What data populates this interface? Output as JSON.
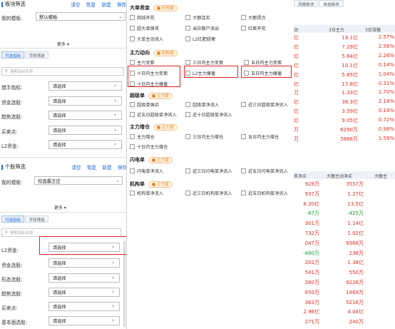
{
  "board_filter": {
    "title": "板块筛选",
    "actions": [
      "请空",
      "恢复",
      "新建",
      "保存"
    ],
    "template_label": "我的模板:",
    "template_value": "默认模板",
    "more": "更多",
    "tabs": [
      "可选指标",
      "字段筛选"
    ],
    "search_placeholder": "搜索指标名称",
    "filters": [
      {
        "label": "猎手指标:",
        "value": "请选择"
      },
      {
        "label": "资金选股:",
        "value": "请选择"
      },
      {
        "label": "趋势选股:",
        "value": "请选择"
      },
      {
        "label": "买卖点:",
        "value": "请选择"
      },
      {
        "label": "L2资金:",
        "value": "请选择"
      }
    ]
  },
  "stock_filter": {
    "title": "个股筛选",
    "actions": [
      "请空",
      "恢复",
      "新建",
      "保存"
    ],
    "template_label": "我的模板:",
    "template_value": "控盘霸王庄",
    "more": "更多",
    "tabs": [
      "可选指标",
      "字段筛选"
    ],
    "search_placeholder": "搜索指标名称",
    "filters": [
      {
        "label": "L2资金:",
        "value": "请选择"
      },
      {
        "label": "资金选股:",
        "value": "请选择"
      },
      {
        "label": "形态选股:",
        "value": "请选择"
      },
      {
        "label": "趋势选股:",
        "value": "请选择"
      },
      {
        "label": "买卖点:",
        "value": "请选择"
      },
      {
        "label": "基本面选股:",
        "value": "请选择"
      }
    ]
  },
  "popup": {
    "sections": [
      {
        "title": "大单资金",
        "badge": "机构版",
        "items": [
          "四线开花",
          "大额连买",
          "大额提点",
          "超大单强攻",
          "当日散户流出",
          "红紫开花",
          "大单主动流入",
          "L2红肥绿瘦"
        ]
      },
      {
        "title": "主力动向",
        "badge": "机构版",
        "items": [
          "主力变紫",
          "三日内主力变紫",
          "五日内主力变紫",
          "十日内主力变紫",
          "L2主力爆量",
          "五日内主力爆量",
          "十日内主力爆量"
        ]
      },
      {
        "title": "超级单",
        "badge": "主力版",
        "items": [
          "超级单强买",
          "超级单净流入",
          "近三日超级单净流入",
          "近五日超级单净流入",
          "近十日超级单净流入"
        ]
      },
      {
        "title": "主力增仓",
        "badge": "主力版",
        "items": [
          "主力增仓",
          "三日内主力增仓",
          "五日内主力增仓",
          "十日内主力增仓"
        ]
      },
      {
        "title": "闪电单",
        "badge": "主力版",
        "items": [
          "闪电单净流入",
          "近三日闪电单净流入",
          "近五日闪电单净流入"
        ]
      },
      {
        "title": "机构单",
        "badge": "主力版",
        "items": [
          "机构单净流入",
          "近三日机构单净流入",
          "近五日机构单净流入"
        ]
      }
    ]
  },
  "right_table": {
    "tabs": [
      "风格板块",
      "自选板块"
    ],
    "top_headers": [
      "动",
      "3日主力",
      "3日涨幅"
    ],
    "top_rows": [
      [
        "亿",
        "19.1亿",
        "2.57%"
      ],
      [
        "亿",
        "7.29亿",
        "2.56%"
      ],
      [
        "亿",
        "5.64亿",
        "2.26%"
      ],
      [
        "亿",
        "10.1亿",
        "0.14%"
      ],
      [
        "亿",
        "5.85亿",
        "1.04%"
      ],
      [
        "亿",
        "17.8亿",
        "0.31%"
      ],
      [
        "万",
        "1.33亿",
        "1.70%"
      ],
      [
        "亿",
        "38.3亿",
        "2.14%"
      ],
      [
        "亿",
        "3.59亿",
        "0.14%"
      ],
      [
        "亿",
        "9.05亿",
        "0.72%"
      ],
      [
        "万",
        "6290万",
        "0.98%"
      ],
      [
        "万",
        "5868万",
        "1.59%"
      ]
    ],
    "bottom_headers": [
      "单净买",
      "大额主动净买",
      "大额主"
    ],
    "bottom_rows": [
      [
        "928万",
        "3557万"
      ],
      [
        "937万",
        "1.27亿"
      ],
      [
        "8.20亿",
        "13.5亿"
      ],
      [
        "-87万",
        "-425万"
      ],
      [
        "301万",
        "1.14亿"
      ],
      [
        "732万",
        "1.02亿"
      ],
      [
        "047万",
        "9368万"
      ],
      [
        "-480万",
        "238万"
      ],
      [
        "202万",
        "1.38亿"
      ],
      [
        "541万",
        "550万"
      ],
      [
        "260万",
        "9226万"
      ],
      [
        "650万",
        "1469万"
      ],
      [
        "363万",
        "5216万"
      ],
      [
        "2.96亿",
        "4.04亿"
      ],
      [
        "271万",
        "240万"
      ]
    ]
  },
  "colors": {
    "red": "#e52a20",
    "green": "#1a9a2a",
    "blue": "#1e6ad9",
    "highlight_box": "#e02020"
  }
}
